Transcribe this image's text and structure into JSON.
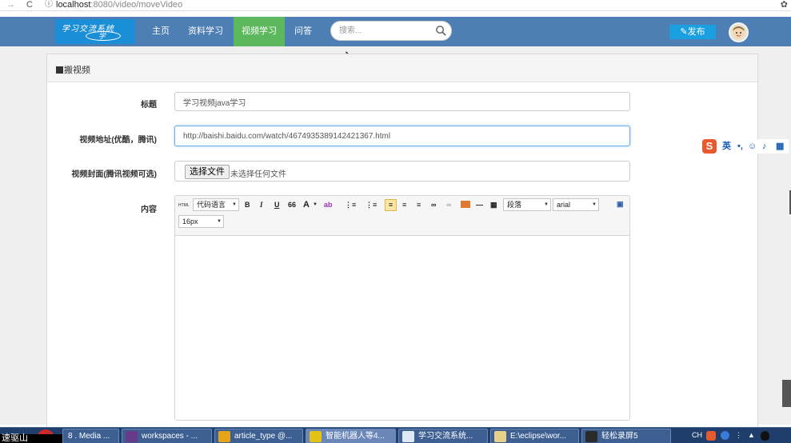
{
  "browser": {
    "back_glyph": "→",
    "reload_glyph": "C",
    "info_glyph": "ⓘ",
    "url_host": "localhost",
    "url_rest": ":8080/video/moveVideo",
    "extension_glyph": "✿"
  },
  "navbar": {
    "logo_text": "学习交流系统",
    "logo_sub": "学",
    "links": [
      {
        "label": "主页"
      },
      {
        "label": "资料学习"
      },
      {
        "label": "视频学习"
      },
      {
        "label": "问答"
      }
    ],
    "search_placeholder": "搜索...",
    "publish_label": "发布",
    "publish_icon": "pencil-icon",
    "colors": {
      "bar": "#4d7eb4",
      "active": "#5cb85c",
      "publish": "#1a9fe0"
    }
  },
  "panel": {
    "title": "搬视频"
  },
  "form": {
    "title_label": "标题",
    "title_value": "学习视频java学习",
    "url_label": "视频地址(优酷，腾讯)",
    "url_value": "http://baishi.baidu.com/watch/4674935389142421367.html",
    "cover_label": "视频封面(腾讯视频可选)",
    "file_button": "选择文件",
    "file_status": "未选择任何文件",
    "content_label": "内容"
  },
  "editor": {
    "html_label": "HTML",
    "code_lang": "代码语言",
    "bold": "B",
    "italic": "I",
    "underline": "U",
    "quote": "66",
    "font_color": "A",
    "paragraph": "段落",
    "font_family": "arial",
    "font_size": "16px"
  },
  "ime": {
    "logo": "S",
    "lang": "英"
  },
  "taskbar": {
    "black_label": "速驱山",
    "tasks": [
      {
        "label": "8 . Media ..."
      },
      {
        "label": "workspaces - ..."
      },
      {
        "label": "article_type @..."
      },
      {
        "label": "智能机器人等4..."
      },
      {
        "label": "学习交流系统..."
      },
      {
        "label": "E:\\eclipse\\wor..."
      },
      {
        "label": "轻松录屏5"
      }
    ],
    "tray_lang": "CH"
  }
}
